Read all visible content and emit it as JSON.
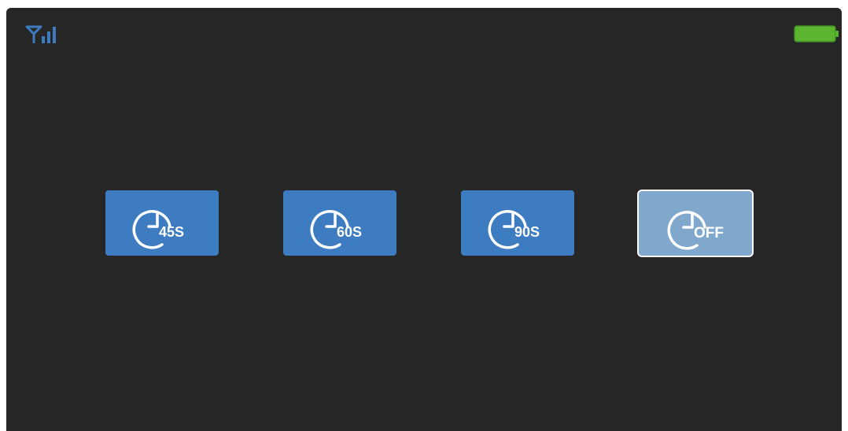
{
  "status_bar": {
    "signal_icon": "signal-strength-icon",
    "battery_icon": "battery-icon",
    "accent_color": "#3e7cc2",
    "battery_color": "#5cb531"
  },
  "timer_options": [
    {
      "label": "45S",
      "icon": "timer-clock-icon",
      "selected": false
    },
    {
      "label": "60S",
      "icon": "timer-clock-icon",
      "selected": false
    },
    {
      "label": "90S",
      "icon": "timer-clock-icon",
      "selected": false
    },
    {
      "label": "OFF",
      "icon": "timer-clock-icon",
      "selected": true
    }
  ],
  "colors": {
    "background": "#262626",
    "button": "#3e7cc2",
    "button_selected": "#80a8cc",
    "button_selected_border": "#ffffff"
  }
}
